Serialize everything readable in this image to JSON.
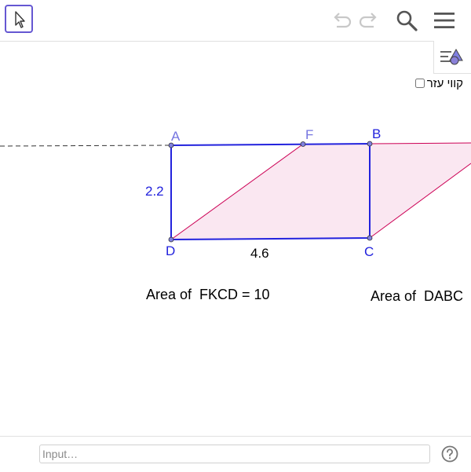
{
  "colors": {
    "accent": "#6557d2",
    "rect_stroke": "#2222dd",
    "para_stroke": "#cc0055",
    "para_fill": "#f5d3e6",
    "point_fill": "#8080e0",
    "label_blue": "#2222dd",
    "label_light": "#7575e0"
  },
  "toolbar": {
    "move_tool_icon": "cursor-arrow-icon",
    "undo_icon": "undo-icon",
    "redo_icon": "redo-icon",
    "search_icon": "magnifier-icon",
    "menu_icon": "hamburger-menu-icon"
  },
  "style_bar": {
    "icon": "style-bar-icon"
  },
  "aux_lines": {
    "label": "קווי עזר",
    "checked": false
  },
  "graphics": {
    "points": {
      "A": "A",
      "F": "F",
      "B": "B",
      "D": "D",
      "C": "C"
    },
    "side_length_ad": "2.2",
    "side_length_dc": "4.6",
    "area_fkcd": "Area of  FKCD = 10",
    "area_dabc": "Area of  DABC"
  },
  "input_bar": {
    "placeholder": "Input…",
    "help_icon": "question-mark-icon"
  }
}
